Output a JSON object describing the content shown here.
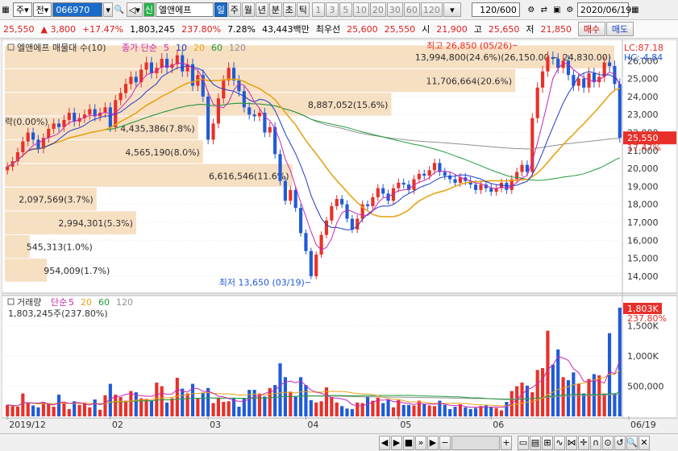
{
  "toolbar": {
    "market_label": "주",
    "type_label": "전",
    "code_value": "066970",
    "stock_name": "엘앤에프",
    "stock_tag": "신",
    "period_tabs": [
      "일",
      "주",
      "월",
      "년",
      "분",
      "초",
      "틱"
    ],
    "active_period": "일",
    "minute_options": [
      "1",
      "3",
      "5",
      "10",
      "20",
      "30",
      "60",
      "120"
    ],
    "count_value": "120",
    "count_total": "/600",
    "date_value": "2020/06/19"
  },
  "quote": {
    "price": "25,550",
    "change": "▲ 3,800",
    "change_pct": "+17.47%",
    "volume": "1,803,245",
    "volume_ratio": "237.80%",
    "turnover": "7.28%",
    "trade_value": "43,443백만",
    "best_label": "최우선",
    "best_ask": "25,600",
    "best_bid": "25,550",
    "open_label": "시",
    "open": "21,900",
    "high_label": "고",
    "high": "25,650",
    "low_label": "저",
    "low": "21,850",
    "buy_label": "매수",
    "sell_label": "매도"
  },
  "colors": {
    "up": "#e8302a",
    "down": "#1f5bd6",
    "ma5": "#c828b4",
    "ma10": "#1e3cc8",
    "ma20": "#e6a417",
    "ma60": "#1f9a3c",
    "ma120": "#909090",
    "band": "#f7dfc2"
  },
  "chart_data": {
    "type": "candlestick",
    "price_legend": {
      "title": "엘앤에프 매물대 수(10)",
      "ma_label": "종가 단순",
      "periods": [
        "5",
        "10",
        "20",
        "60",
        "120"
      ]
    },
    "volume_legend": {
      "title": "거래량",
      "ma_label": "단순",
      "periods": [
        "5",
        "20",
        "60",
        "120"
      ]
    },
    "price_axis": {
      "ticks": [
        14000,
        15000,
        16000,
        17000,
        18000,
        19000,
        20000,
        21000,
        22000,
        23000,
        24000,
        25000,
        26000
      ],
      "tick_labels": [
        "14,000",
        "15,000",
        "16,000",
        "17,000",
        "18,000",
        "19,000",
        "20,000",
        "21,000",
        "22,000",
        "23,000",
        "24,000",
        "25,000",
        "26,000"
      ],
      "range": [
        13100,
        27000
      ]
    },
    "indicators": {
      "lc": "LC:87.18",
      "hc": "HC:-4.84",
      "last_price": "25,550",
      "last_pct": "17.47%"
    },
    "volume_axis": {
      "ticks": [
        500000,
        1000000,
        1500000
      ],
      "tick_labels": [
        "500,000",
        "1,000K",
        "1,500K"
      ],
      "range": [
        0,
        1950000
      ]
    },
    "volume_now": {
      "value": "1,803K",
      "pct": "237.80%"
    },
    "volume_text": "1,803,245주(237.80%)",
    "x_labels": [
      "2019/12",
      "02",
      "03",
      "04",
      "05",
      "06",
      "06/19"
    ],
    "x_label_index": [
      0,
      20,
      39,
      58,
      76,
      94,
      119
    ],
    "annotations": {
      "high": "최고 26,850 (05/26)",
      "low": "최저 13,650 (03/19)",
      "high_index": 99,
      "low_index": 59,
      "high_value": 26850,
      "low_value": 13650
    },
    "volume_profile": [
      {
        "label": "954,009(1.7%)",
        "low": 13650,
        "high": 14970,
        "pct": 1.7
      },
      {
        "label": "545,313(1.0%)",
        "low": 14970,
        "high": 16290,
        "pct": 1.0
      },
      {
        "label": "2,994,301(5.3%)",
        "low": 16290,
        "high": 17610,
        "pct": 5.3
      },
      {
        "label": "2,097,569(3.7%)",
        "low": 17610,
        "high": 18930,
        "pct": 3.7
      },
      {
        "label": "6,616,546(11.6%)",
        "low": 18930,
        "high": 20250,
        "pct": 11.6
      },
      {
        "label": "4,565,190(8.0%)",
        "low": 20250,
        "high": 21570,
        "pct": 8.0
      },
      {
        "label": "4,435,386(7.8%)",
        "low": 21570,
        "high": 22890,
        "pct": 7.8
      },
      {
        "label": "8,887,052(15.6%)",
        "low": 22890,
        "high": 24210,
        "pct": 15.6
      },
      {
        "label": "11,706,664(20.6%)",
        "low": 24210,
        "high": 25530,
        "pct": 20.6
      },
      {
        "label": "13,994,800(24.6%)(26,150.00 ~ 24,830.00)",
        "low": 25530,
        "high": 26850,
        "pct": 24.6
      }
    ],
    "left_label": "락(0.00%)",
    "closes": [
      20100,
      20400,
      20900,
      21500,
      22000,
      21600,
      21100,
      21700,
      22200,
      22500,
      22300,
      22700,
      23100,
      22600,
      22800,
      23000,
      23300,
      22900,
      23100,
      23400,
      22300,
      23800,
      24200,
      24700,
      25100,
      24800,
      25500,
      25900,
      25300,
      25600,
      26100,
      25600,
      25800,
      26300,
      25400,
      25800,
      24600,
      25200,
      24000,
      21600,
      22500,
      23900,
      24900,
      25600,
      24900,
      24300,
      23400,
      23000,
      22900,
      23100,
      22000,
      22300,
      20800,
      19300,
      18200,
      18800,
      17800,
      16400,
      15400,
      14000,
      15200,
      16300,
      17100,
      17900,
      18300,
      18000,
      17200,
      16600,
      17200,
      18000,
      17900,
      18400,
      18900,
      18600,
      18200,
      18900,
      19200,
      19100,
      18800,
      19400,
      19700,
      19600,
      19900,
      20300,
      19800,
      19600,
      19400,
      19200,
      19500,
      19300,
      19100,
      18800,
      19100,
      18900,
      18700,
      18900,
      19200,
      18800,
      19400,
      19800,
      20200,
      19800,
      22800,
      24500,
      25400,
      26200,
      26100,
      25600,
      26000,
      25200,
      24600,
      25000,
      24500,
      25300,
      24800,
      25100,
      25900,
      25700,
      24700,
      21700
    ],
    "volumes": [
      190000,
      170000,
      160000,
      380000,
      230000,
      180000,
      150000,
      240000,
      210000,
      160000,
      360000,
      230000,
      120000,
      250000,
      190000,
      230000,
      150000,
      280000,
      110000,
      350000,
      540000,
      360000,
      320000,
      260000,
      420000,
      400000,
      300000,
      290000,
      260000,
      560000,
      500000,
      230000,
      300000,
      640000,
      460000,
      380000,
      540000,
      300000,
      390000,
      470000,
      220000,
      300000,
      240000,
      250000,
      300000,
      160000,
      300000,
      440000,
      440000,
      380000,
      330000,
      470000,
      520000,
      880000,
      650000,
      410000,
      330000,
      650000,
      520000,
      270000,
      230000,
      250000,
      480000,
      320000,
      230000,
      170000,
      130000,
      120000,
      230000,
      220000,
      330000,
      260000,
      310000,
      220000,
      280000,
      150000,
      270000,
      190000,
      190000,
      180000,
      260000,
      210000,
      180000,
      170000,
      260000,
      190000,
      120000,
      160000,
      200000,
      150000,
      120000,
      140000,
      170000,
      180000,
      160000,
      140000,
      100000,
      240000,
      420000,
      500000,
      560000,
      510000,
      400000,
      770000,
      800000,
      1420000,
      860000,
      1110000,
      650000,
      600000,
      730000,
      540000,
      380000,
      620000,
      700000,
      680000,
      380000,
      1380000,
      380000,
      1803245
    ],
    "ranges": {
      "hi_pct": 0.012,
      "lo_pct": 0.012
    }
  }
}
